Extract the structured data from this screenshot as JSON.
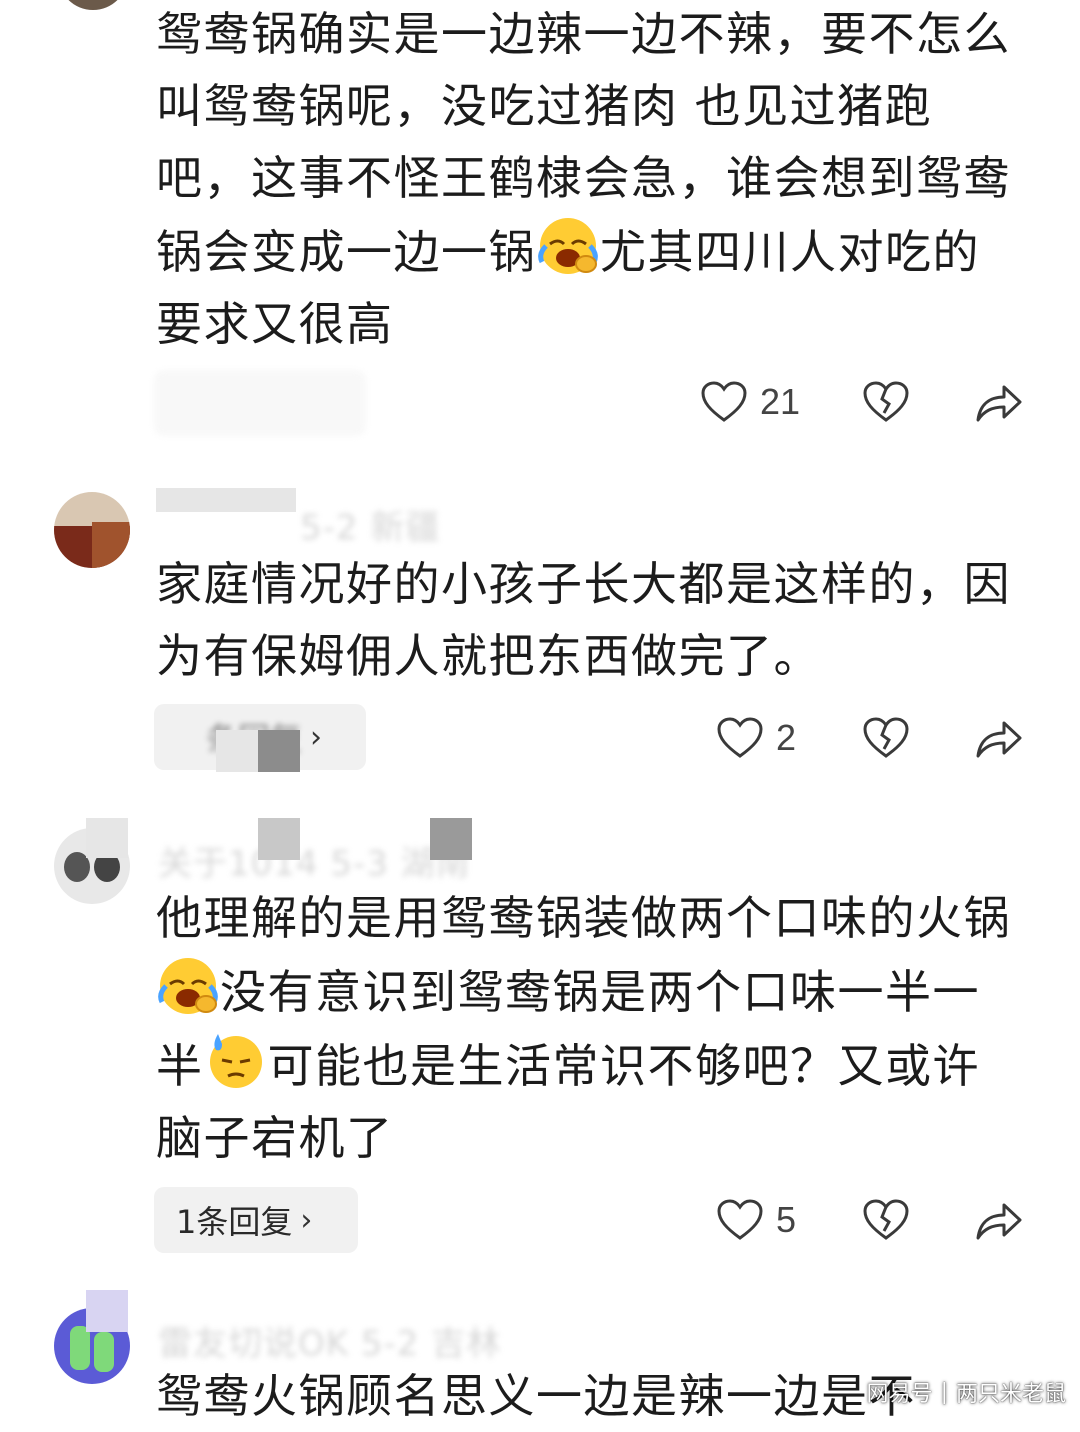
{
  "comments": [
    {
      "text": "鸳鸯锅确实是一边辣一边不辣，要不怎么叫鸳鸯锅呢，没吃过猪肉 也见过猪跑吧，这事不怪王鹤棣会急，谁会想到鸳鸯锅会变成一边一锅",
      "text2": "尤其四川人对吃的要求又很高",
      "emoji": "laughing-crying-emoji",
      "likes": "21"
    },
    {
      "meta": "5-2 新疆",
      "text": "家庭情况好的小孩子长大都是这样的，因为有保姆佣人就把东西做完了。",
      "reply_label": "条回复",
      "likes": "2"
    },
    {
      "meta": "关于1014  5-3  湖南",
      "text_a": "他理解的是用鸳鸯锅装做两个口味的火锅",
      "text_b": "没有意识到鸳鸯锅是两个口味一半一半",
      "text_c": "可能也是生活常识不够吧？又或许脑子宕机了",
      "emoji_a": "laughing-crying-emoji",
      "emoji_b": "sweat-emoji",
      "reply_label": "1条回复",
      "likes": "5"
    },
    {
      "meta": "雷友切说OK  5-2  吉林",
      "text": "鸳鸯火锅顾名思义一边是辣一边是不"
    }
  ],
  "icons": {
    "like": "heart-outline-icon",
    "dislike": "broken-heart-icon",
    "share": "share-arrow-icon"
  },
  "watermark": {
    "brand": "网易号",
    "author": "两只米老鼠"
  }
}
